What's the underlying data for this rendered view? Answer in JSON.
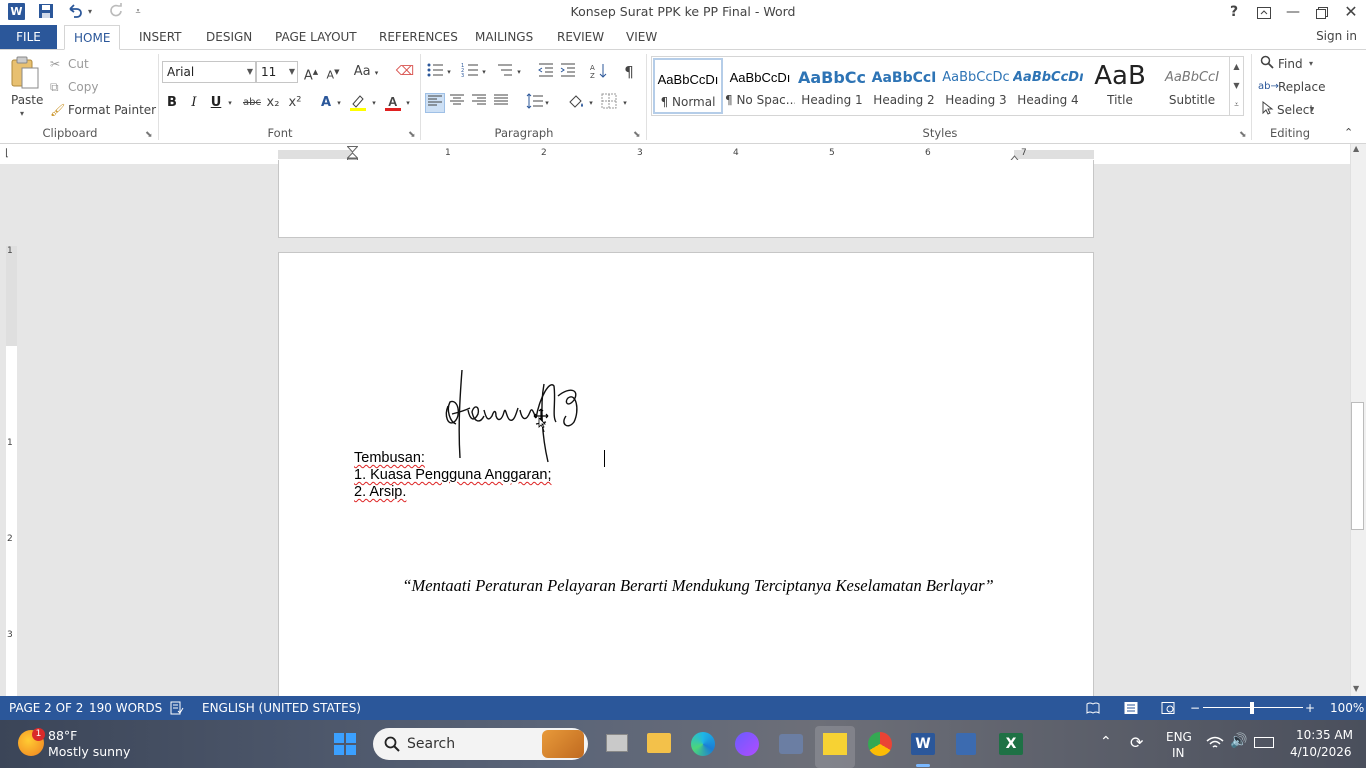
{
  "window": {
    "title": "Konsep Surat PPK ke PP Final - Word",
    "help": "?",
    "signin": "Sign in"
  },
  "tabs": [
    "FILE",
    "HOME",
    "INSERT",
    "DESIGN",
    "PAGE LAYOUT",
    "REFERENCES",
    "MAILINGS",
    "REVIEW",
    "VIEW"
  ],
  "clipboard": {
    "paste": "Paste",
    "cut": "Cut",
    "copy": "Copy",
    "format_painter": "Format Painter",
    "label": "Clipboard"
  },
  "font": {
    "name": "Arial",
    "size": "11",
    "label": "Font",
    "bold": "B",
    "italic": "I",
    "underline": "U",
    "strike": "abc",
    "sub": "x₂",
    "sup": "x²",
    "change_case": "Aa"
  },
  "paragraph": {
    "label": "Paragraph"
  },
  "styles": {
    "label": "Styles",
    "items": [
      {
        "preview": "AaBbCcDı",
        "name": "¶ Normal"
      },
      {
        "preview": "AaBbCcDı",
        "name": "¶ No Spac..."
      },
      {
        "preview": "AaBbCc",
        "name": "Heading 1"
      },
      {
        "preview": "AaBbCcI",
        "name": "Heading 2"
      },
      {
        "preview": "AaBbCcDc",
        "name": "Heading 3"
      },
      {
        "preview": "AaBbCcDı",
        "name": "Heading 4"
      },
      {
        "preview": "AaB",
        "name": "Title"
      },
      {
        "preview": "AaBbCcI",
        "name": "Subtitle"
      }
    ]
  },
  "editing": {
    "find": "Find",
    "replace": "Replace",
    "select": "Select",
    "label": "Editing"
  },
  "ruler": {
    "numbers": [
      "1",
      "2",
      "3",
      "4",
      "5",
      "6",
      "7"
    ],
    "vnumbers": [
      "1",
      "1",
      "2",
      "3"
    ]
  },
  "document": {
    "tembusan": "Tembusan:",
    "item1": "1. Kuasa Pengguna Anggaran;",
    "item2": "2. Arsip.",
    "motto": "“Mentaati Peraturan Pelayaran Berarti Mendukung Terciptanya Keselamatan Berlayar”"
  },
  "status": {
    "page": "PAGE 2 OF 2",
    "words": "190 WORDS",
    "language": "ENGLISH (UNITED STATES)",
    "zoom": "100%"
  },
  "taskbar": {
    "weather_temp": "88°F",
    "weather_desc": "Mostly sunny",
    "weather_badge": "1",
    "search": "Search",
    "lang1": "ENG",
    "lang2": "IN",
    "time": "10:35 AM",
    "date": "4/10/2026"
  }
}
